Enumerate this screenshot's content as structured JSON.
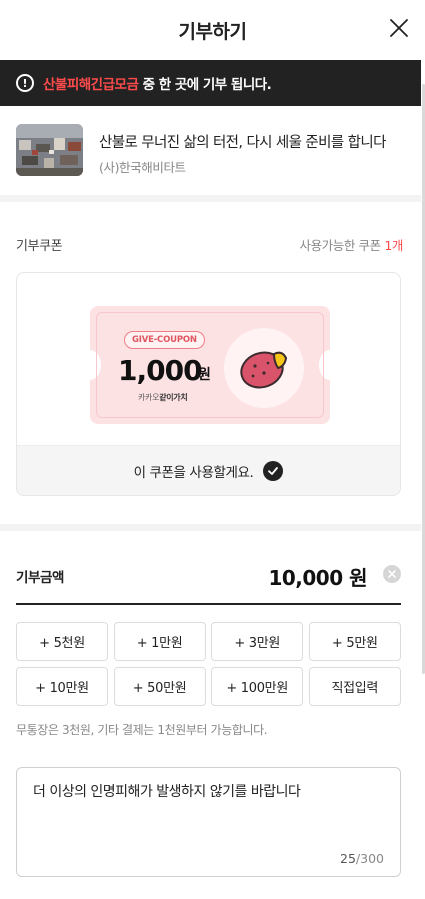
{
  "header": {
    "title": "기부하기",
    "close_icon": "close-icon"
  },
  "notice": {
    "icon": "exclamation-circle-icon",
    "highlight": "산불피해긴급모금",
    "text": " 중 한 곳에 기부 됩니다.",
    "highlight_color": "#ff4b4b"
  },
  "campaign": {
    "title": "산불로 무너진 삶의 터전, 다시 세울 준비를 합니다",
    "org": "(사)한국해비타트"
  },
  "coupon": {
    "label": "기부쿠폰",
    "available_prefix": "사용가능한 쿠폰 ",
    "available_count": "1개",
    "badge": "GIVE-COUPON",
    "amount": "1,000",
    "unit": "원",
    "brand_prefix": "카카오",
    "brand_bold": "같이가치",
    "use_label": "이 쿠폰을 사용할게요.",
    "use_icon": "check-circle-icon"
  },
  "donation": {
    "label": "기부금액",
    "value": "10,000 원",
    "clear_icon": "clear-icon",
    "buttons": [
      "+ 5천원",
      "+ 1만원",
      "+ 3만원",
      "+ 5만원",
      "+ 10만원",
      "+ 50만원",
      "+ 100만원",
      "직접입력"
    ],
    "note": "무통장은 3천원, 기타 결제는 1천원부터 가능합니다."
  },
  "message": {
    "text": "더 이상의 인명피해가 발생하지 않기를 바랍니다",
    "count": "25",
    "max": "/300"
  },
  "colors": {
    "accent_red": "#ff4b4b",
    "dark": "#222222",
    "coupon_pink": "#fde2e4"
  }
}
